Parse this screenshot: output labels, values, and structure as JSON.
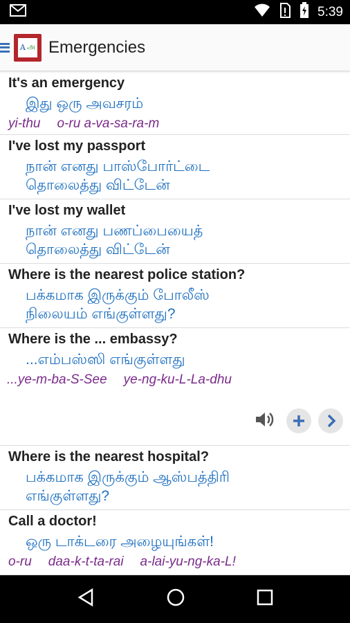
{
  "status": {
    "time": "5:39"
  },
  "appbar": {
    "title": "Emergencies",
    "logo_left": "A",
    "logo_right": "அ"
  },
  "phrases": [
    {
      "title": "It's an emergency",
      "native": [
        "இது ஒரு அவசரம்"
      ],
      "translit": [
        "yi-thu",
        "o-ru a-va-sa-ra-m"
      ]
    },
    {
      "title": "I've lost my passport",
      "native": [
        "நான் எனது பாஸ்போர்ட்டை",
        "தொலைத்து விட்டேன்"
      ],
      "translit": []
    },
    {
      "title": "I've lost my wallet",
      "native": [
        "நான் எனது பணப்பையைத்",
        "தொலைத்து விட்டேன்"
      ],
      "translit": []
    },
    {
      "title": "Where is the nearest police station?",
      "native": [
        "பக்கமாக இருக்கும் போலீஸ்",
        "நிலையம் எங்குள்ளது?"
      ],
      "translit": []
    },
    {
      "title": "Where is the ... embassy?",
      "native": [
        "...எம்பஸ்ஸி எங்குள்ளது"
      ],
      "translit": [
        "...ye-m-ba-S-See",
        "ye-ng-ku-L-La-dhu"
      ]
    },
    {
      "title": "Where is the nearest hospital?",
      "native": [
        "பக்கமாக இருக்கும் ஆஸ்பத்திரி",
        "எங்குள்ளது?"
      ],
      "translit": []
    },
    {
      "title": "Call a doctor!",
      "native": [
        "ஒரு டாக்டரை அழையுங்கள்!"
      ],
      "translit": [
        "o-ru",
        "daa-k-t-ta-rai",
        "a-lai-yu-ng-ka-L!"
      ]
    }
  ],
  "colors": {
    "title": "#222222",
    "native": "#1d6fbf",
    "translit": "#7a2a8a",
    "accent": "#3b6fb6"
  },
  "icons": [
    "gmail-icon",
    "wifi-icon",
    "no-sim-icon",
    "battery-icon",
    "menu-icon",
    "speaker-icon",
    "plus-icon",
    "chevron-right-icon",
    "back-icon",
    "home-icon",
    "recents-icon"
  ]
}
